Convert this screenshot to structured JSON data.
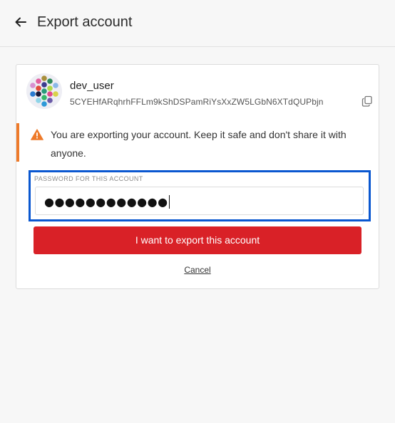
{
  "header": {
    "title": "Export account",
    "back_icon": "arrow-left-icon"
  },
  "account": {
    "name": "dev_user",
    "address": "5CYEHfARqhrhFFLm9kShDSPamRiYsXxZW5LGbN6XTdQUPbjn",
    "identicon_icon": "identicon",
    "copy_icon": "copy-icon"
  },
  "warning": {
    "icon": "warning-triangle-icon",
    "text": "You are exporting your account. Keep it safe and don't share it with anyone.",
    "accent_color": "#ee7a2a"
  },
  "password": {
    "label": "PASSWORD FOR THIS ACCOUNT",
    "value": "●●●●●●●●●●●●",
    "focus_color": "#0a57d0"
  },
  "actions": {
    "export_label": "I want to export this account",
    "export_color": "#d92127",
    "cancel_label": "Cancel"
  }
}
